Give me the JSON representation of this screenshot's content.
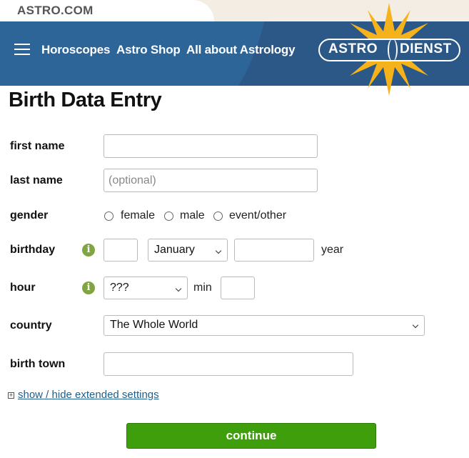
{
  "site": {
    "logo_text": "ASTRO.COM"
  },
  "nav": {
    "links": [
      "Horoscopes",
      "Astro Shop",
      "All about Astrology"
    ],
    "brand_left": "ASTRO",
    "brand_right": "DIENST"
  },
  "page": {
    "title": "Birth Data Entry"
  },
  "form": {
    "first_name": {
      "label": "first name",
      "value": "",
      "placeholder": ""
    },
    "last_name": {
      "label": "last name",
      "value": "",
      "placeholder": "(optional)"
    },
    "gender": {
      "label": "gender",
      "options": [
        "female",
        "male",
        "event/other"
      ]
    },
    "birthday": {
      "label": "birthday",
      "day": "",
      "month": "January",
      "year": "",
      "year_label": "year"
    },
    "hour": {
      "label": "hour",
      "hour": "???",
      "min_label": "min",
      "minute": ""
    },
    "country": {
      "label": "country",
      "value": "The Whole World"
    },
    "birth_town": {
      "label": "birth town",
      "value": ""
    },
    "extended_settings_link": "show / hide extended settings",
    "submit_label": "continue"
  },
  "colors": {
    "nav_bg": "#2b5886",
    "sun": "#f6b21b",
    "continue_bg": "#3f9e0b",
    "info_icon": "#7ea542",
    "link": "#1f5e8a"
  }
}
